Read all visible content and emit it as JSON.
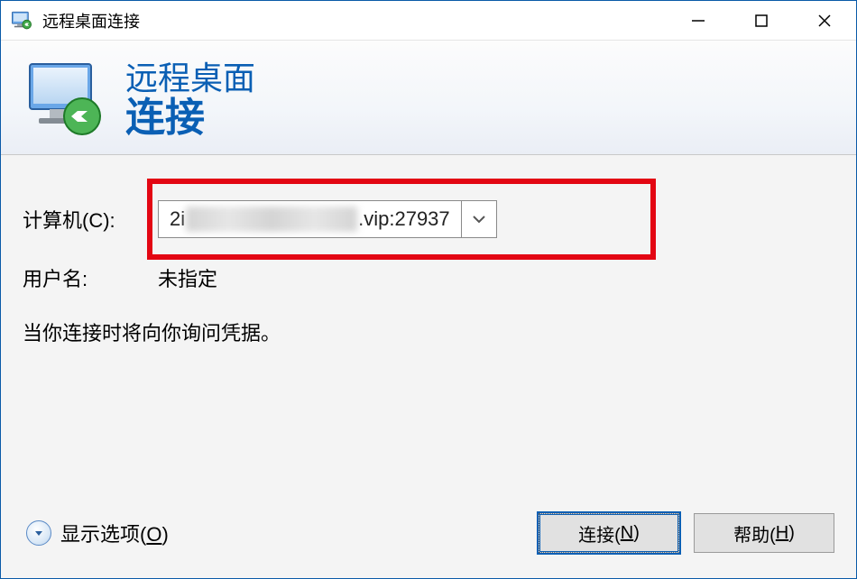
{
  "window": {
    "title": "远程桌面连接"
  },
  "banner": {
    "line1": "远程桌面",
    "line2": "连接"
  },
  "form": {
    "computer_label": "计算机(C):",
    "computer_value_prefix": "2i",
    "computer_value_suffix": ".vip:27937",
    "username_label": "用户名:",
    "username_value": "未指定",
    "credential_note": "当你连接时将向你询问凭据。"
  },
  "footer": {
    "show_options": "显示选项(",
    "show_options_u": "O",
    "show_options_end": ")",
    "connect": "连接(",
    "connect_u": "N",
    "connect_end": ")",
    "help": "帮助(",
    "help_u": "H",
    "help_end": ")"
  }
}
